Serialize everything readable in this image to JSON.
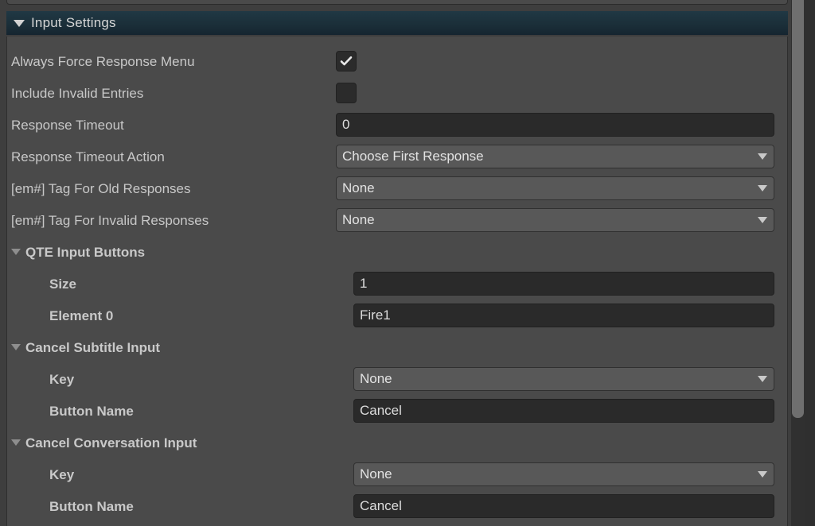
{
  "section": {
    "title": "Input Settings",
    "expanded": true,
    "foldout_icon": "triangle-down-icon"
  },
  "colors": {
    "header_bg": "#1b2f39",
    "panel_bg": "#4a4a4a",
    "window_bg": "#3e3e3e",
    "text": "#c8c8c8",
    "field_bg": "#2a2a2a",
    "dropdown_bg": "#585858",
    "scrollbar_thumb": "#6f6f6f"
  },
  "rows": [
    {
      "label": "Always Force Response Menu",
      "indent": 0,
      "bold": false,
      "control": "checkbox",
      "checked": true,
      "value": "true"
    },
    {
      "label": "Include Invalid Entries",
      "indent": 0,
      "bold": false,
      "control": "checkbox",
      "checked": false,
      "value": "false"
    },
    {
      "label": "Response Timeout",
      "indent": 0,
      "bold": false,
      "control": "textfield",
      "value": "0"
    },
    {
      "label": "Response Timeout Action",
      "indent": 0,
      "bold": false,
      "control": "dropdown",
      "value": "Choose First Response"
    },
    {
      "label": "[em#] Tag For Old Responses",
      "indent": 0,
      "bold": false,
      "control": "dropdown",
      "value": "None"
    },
    {
      "label": "[em#] Tag For Invalid Responses",
      "indent": 0,
      "bold": false,
      "control": "dropdown",
      "value": "None"
    },
    {
      "label": "QTE Input Buttons",
      "indent": 0,
      "bold": true,
      "control": "foldout",
      "expanded": true,
      "value": ""
    },
    {
      "label": "Size",
      "indent": 2,
      "bold": true,
      "control": "textfield",
      "value": "1"
    },
    {
      "label": "Element 0",
      "indent": 2,
      "bold": true,
      "control": "textfield",
      "value": "Fire1"
    },
    {
      "label": "Cancel Subtitle Input",
      "indent": 0,
      "bold": true,
      "control": "foldout",
      "expanded": true,
      "value": ""
    },
    {
      "label": "Key",
      "indent": 2,
      "bold": true,
      "control": "dropdown",
      "value": "None"
    },
    {
      "label": "Button Name",
      "indent": 2,
      "bold": true,
      "control": "textfield",
      "value": "Cancel"
    },
    {
      "label": "Cancel Conversation Input",
      "indent": 0,
      "bold": true,
      "control": "foldout",
      "expanded": true,
      "value": ""
    },
    {
      "label": "Key",
      "indent": 2,
      "bold": true,
      "control": "dropdown",
      "value": "None"
    },
    {
      "label": "Button Name",
      "indent": 2,
      "bold": true,
      "control": "textfield",
      "value": "Cancel"
    }
  ]
}
